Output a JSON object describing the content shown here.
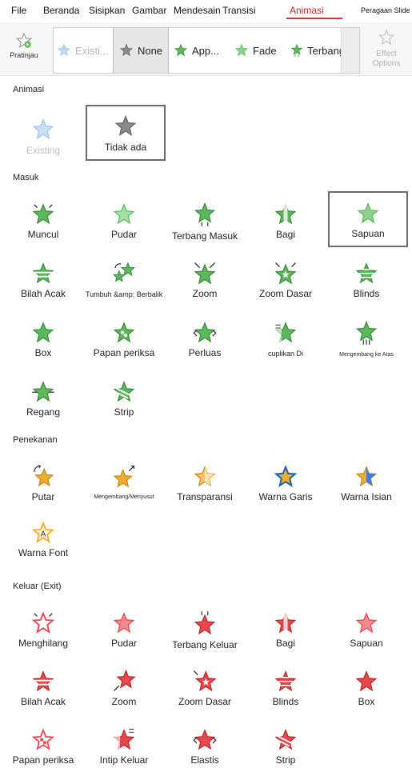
{
  "menubar": {
    "file": "File",
    "home": "Beranda",
    "insert": "Sisipkan",
    "draw": "Gambar",
    "design": "Mendesain",
    "transitions": "Transisi",
    "animations": "Animasi",
    "slideshow": "Peragaan Slide"
  },
  "ribbon": {
    "preview_label": "Pratinjau",
    "gallery": {
      "existing": "Existi...",
      "none": "None",
      "appear": "App...",
      "fade": "Fade",
      "fly_in": "Terbang Masuk"
    },
    "effect_options": "Effect Options"
  },
  "panel": {
    "sections": {
      "animation": "Animasi",
      "entrance": "Masuk",
      "emphasis": "Penekanan",
      "exit": "Keluar (Exit)"
    },
    "animation": {
      "existing": "Existing",
      "none": "Tidak ada"
    },
    "entrance": {
      "appear": "Muncul",
      "fade": "Pudar",
      "fly_in": "Terbang Masuk",
      "split": "Bagi",
      "wipe": "Sapuan",
      "random_bars": "Bilah Acak",
      "grow_turn": "Tumbuh &amp; Berbalik",
      "zoom": "Zoom",
      "basic_zoom": "Zoom Dasar",
      "blinds": "Blinds",
      "box": "Box",
      "checkerboard": "Papan periksa",
      "expand": "Perluas",
      "peek_in": "cuplikan Di",
      "rise_up": "Mengembang ke Atas",
      "stretch": "Regang",
      "strips": "Strip"
    },
    "emphasis": {
      "spin": "Putar",
      "grow_shrink": "Mengembang/Menyusut",
      "transparency": "Transparansi",
      "line_color": "Warna Garis",
      "fill_color": "Warna Isian",
      "font_color": "Warna Font"
    },
    "exit": {
      "disappear": "Menghilang",
      "fade": "Pudar",
      "fly_out": "Terbang Keluar",
      "split": "Bagi",
      "wipe": "Sapuan",
      "random_bars": "Bilah Acak",
      "zoom": "Zoom",
      "basic_zoom": "Zoom Dasar",
      "blinds": "Blinds",
      "box": "Box",
      "checkerboard": "Papan periksa",
      "peek_out": "Intip Keluar",
      "elastic": "Elastis",
      "strips": "Strip"
    }
  },
  "colors": {
    "entrance": "#5cb85c",
    "emphasis": "#f0ad2e",
    "exit": "#e8474e",
    "none": "#8a8a8a",
    "existing": "#9cc4ea",
    "active_tab": "#b52a2a"
  },
  "icons": {
    "entrance": "green-star-icon",
    "emphasis": "gold-star-icon",
    "exit": "red-star-icon",
    "none": "gray-star-icon",
    "existing": "blue-star-icon"
  }
}
